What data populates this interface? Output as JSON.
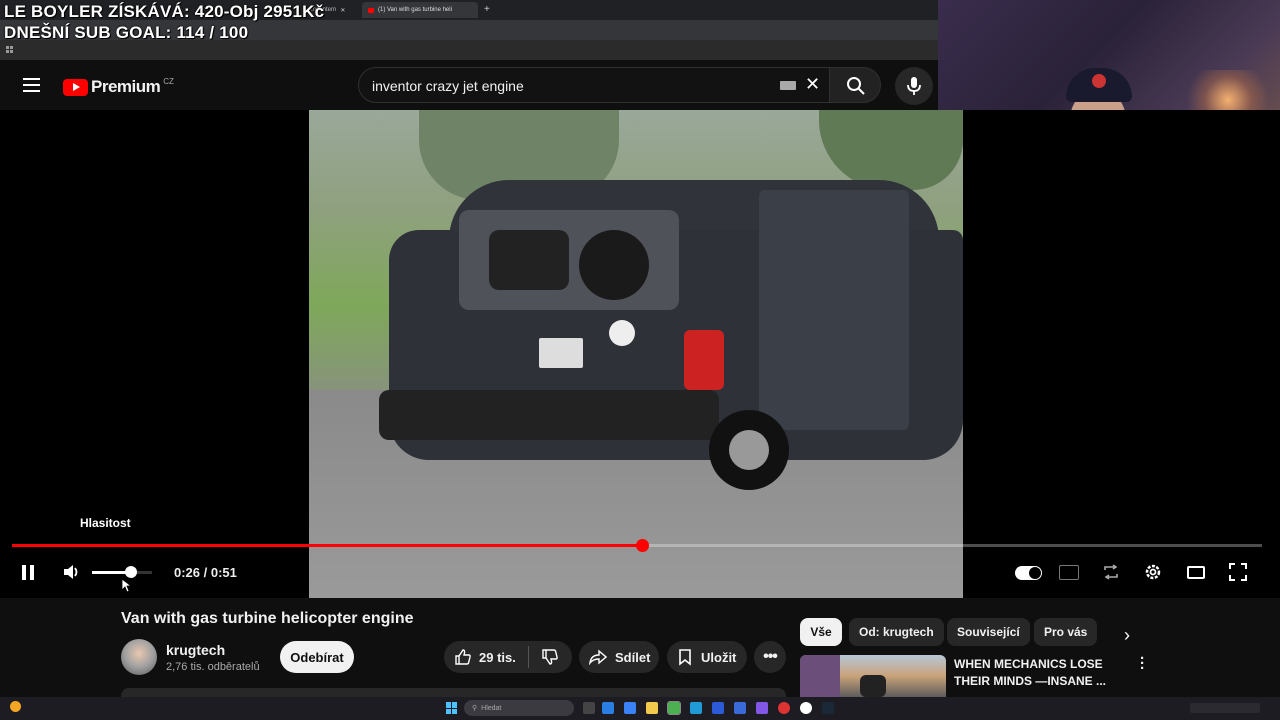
{
  "browser": {
    "tabs": [
      {
        "label": "",
        "active": false
      },
      {
        "label": "...the Intern",
        "active": false
      },
      {
        "label": "(1) Van with gas turbine heli",
        "active": true
      }
    ],
    "new_tab": "+"
  },
  "overlay": {
    "line1": "LE BOYLER ZÍSKÁVÁ: 420-Obj 2951Kč",
    "line2": "DNEŠNÍ SUB GOAL: 114 / 100"
  },
  "header": {
    "logo_text": "Premium",
    "region": "CZ",
    "search_value": "inventor crazy jet engine"
  },
  "player": {
    "tooltip": "Hlasitost",
    "time": "0:26 / 0:51",
    "progress": 0.504,
    "volume": 0.65
  },
  "video": {
    "title": "Van with gas turbine helicopter engine",
    "channel": "krugtech",
    "subscribers": "2,76 tis. odběratelů",
    "subscribe_label": "Odebírat",
    "likes": "29 tis.",
    "share_label": "Sdílet",
    "save_label": "Uložit"
  },
  "chips": [
    "Vše",
    "Od: krugtech",
    "Související",
    "Pro vás"
  ],
  "recommendation": {
    "title_line1": "WHEN MECHANICS LOSE",
    "title_line2": "THEIR MINDS —INSANE ..."
  },
  "taskbar": {
    "search_placeholder": "Hledat"
  },
  "colors": {
    "accent": "#ff0000",
    "background": "#0f0f0f",
    "pill": "#272727"
  }
}
